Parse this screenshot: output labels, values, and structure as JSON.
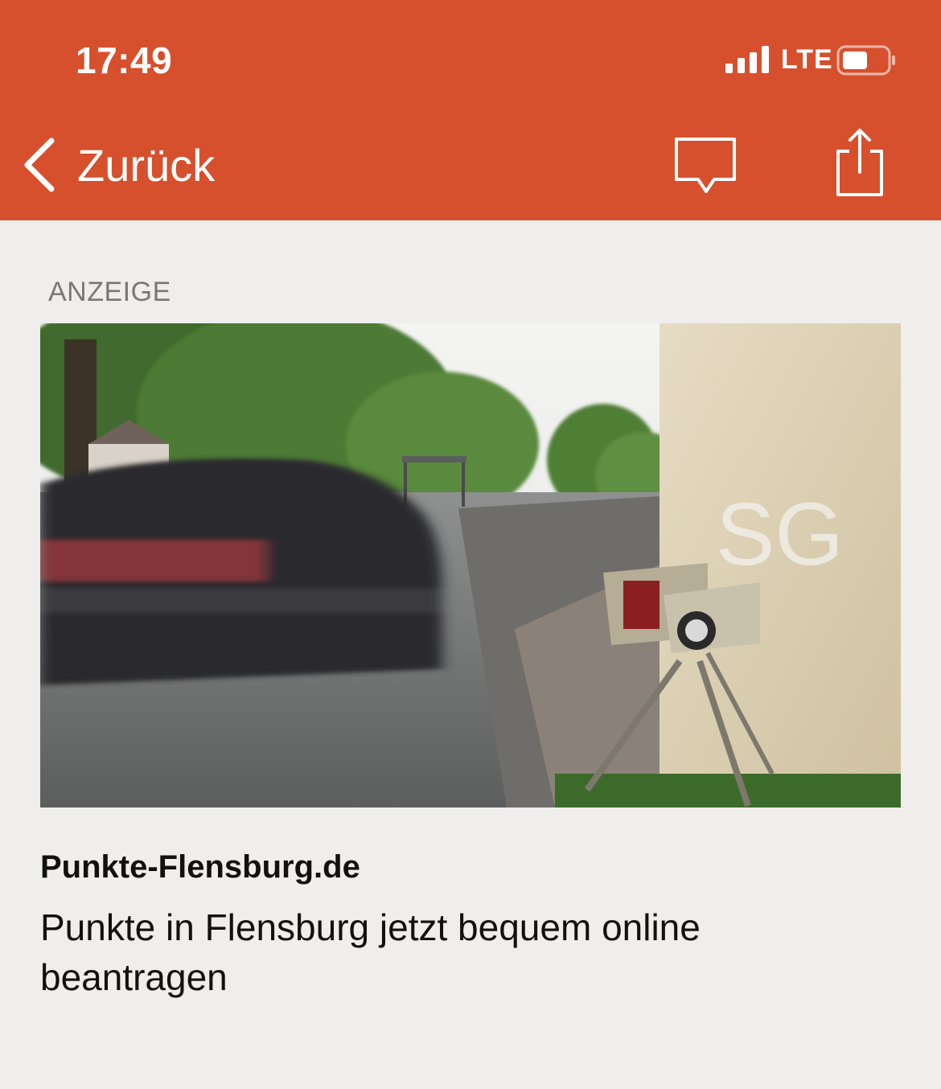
{
  "status_bar": {
    "time": "17:49",
    "network": "LTE",
    "signal_bars": 4,
    "battery_level": 0.5
  },
  "nav": {
    "back_label": "Zurück",
    "back_icon": "chevron-left-icon",
    "comment_icon": "comment-icon",
    "share_icon": "share-icon"
  },
  "ad": {
    "label": "ANZEIGE",
    "source": "Punkte-Flensburg.de",
    "text": "Punkte in Flensburg jetzt bequem online beantragen"
  },
  "colors": {
    "header": "#d6502d",
    "background": "#efeeec"
  }
}
